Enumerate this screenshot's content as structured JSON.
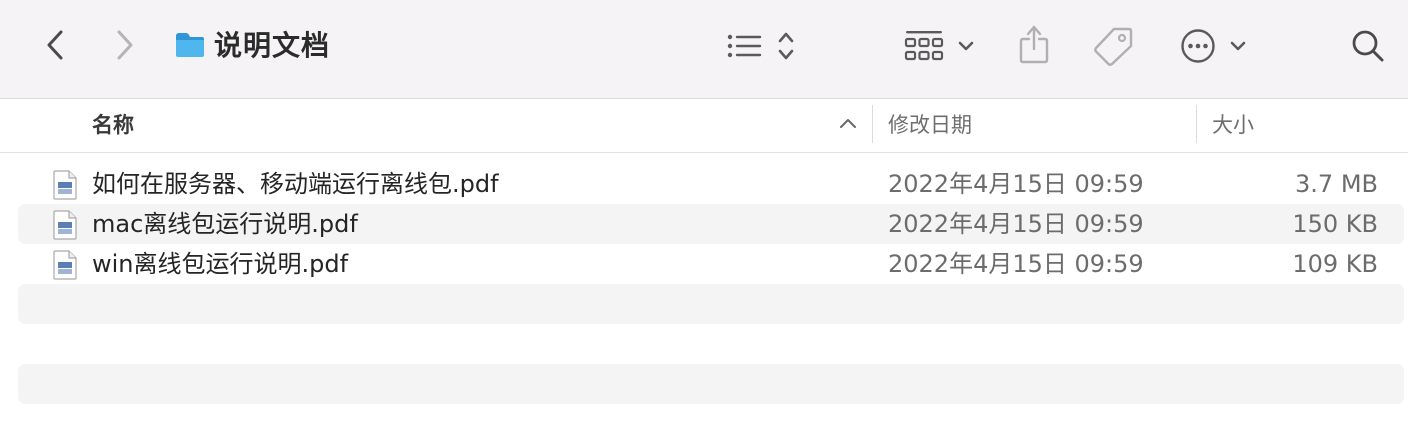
{
  "toolbar": {
    "title": "说明文档",
    "icons": {
      "back": "chevron-left-icon",
      "forward": "chevron-right-icon",
      "folder": "folder-icon",
      "list_view": "list-view-icon",
      "sort": "up-down-chevron-icon",
      "group": "grid-group-icon",
      "group_menu": "chevron-down-icon",
      "share": "share-icon",
      "tag": "tag-icon",
      "more": "ellipsis-circle-icon",
      "more_menu": "chevron-down-icon",
      "search": "search-icon"
    },
    "folder_color": "#3aa8e8"
  },
  "columns": {
    "name": "名称",
    "date": "修改日期",
    "size": "大小",
    "sort_indicator": "chevron-up-icon"
  },
  "files": [
    {
      "name": "如何在服务器、移动端运行离线包.pdf",
      "date": "2022年4月15日 09:59",
      "size": "3.7 MB",
      "icon": "pdf-file-icon"
    },
    {
      "name": "mac离线包运行说明.pdf",
      "date": "2022年4月15日 09:59",
      "size": "150 KB",
      "icon": "pdf-file-icon"
    },
    {
      "name": "win离线包运行说明.pdf",
      "date": "2022年4月15日 09:59",
      "size": "109 KB",
      "icon": "pdf-file-icon"
    }
  ]
}
